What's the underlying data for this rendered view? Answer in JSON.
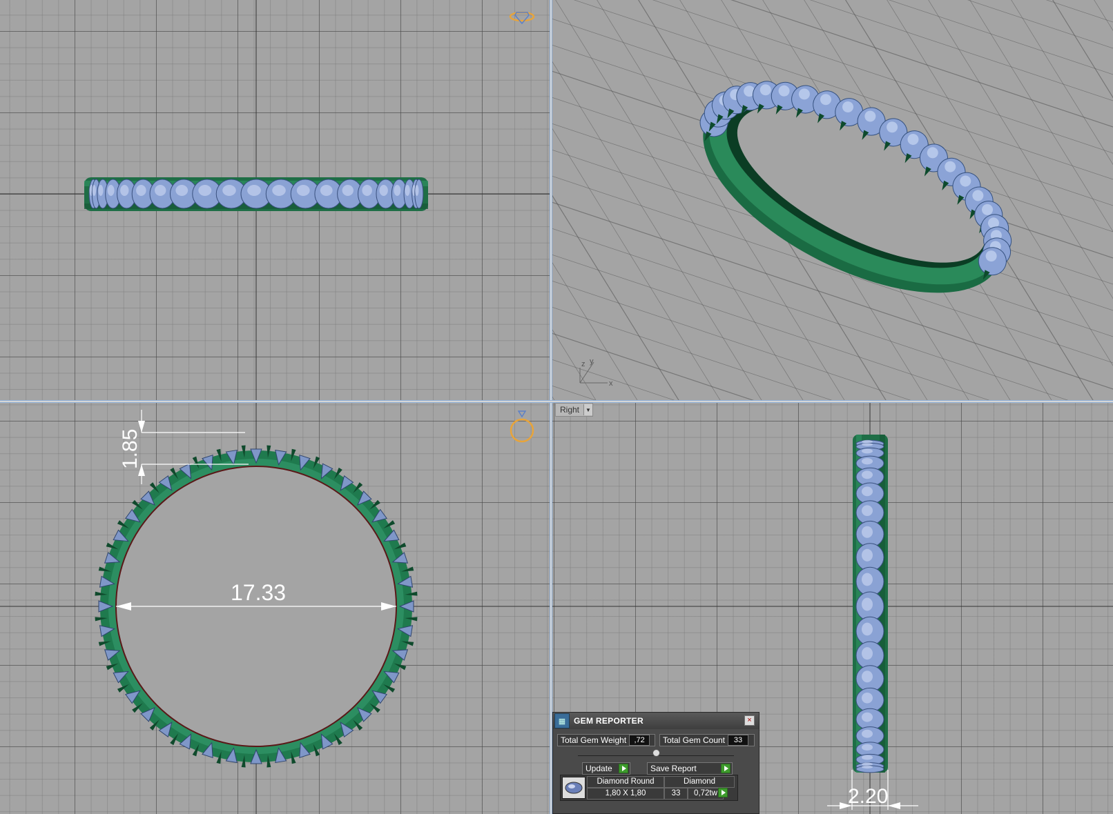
{
  "viewports": {
    "right_label": "Right",
    "axes": {
      "z": "z",
      "y": "y",
      "x": "x"
    }
  },
  "dimensions": {
    "band_height": "1.85",
    "inner_diameter": "17.33",
    "band_width": "2.20"
  },
  "gem_reporter": {
    "title": "GEM REPORTER",
    "total_weight_label": "Total Gem Weight",
    "total_weight_value": ",72",
    "total_count_label": "Total Gem Count",
    "total_count_value": "33",
    "update_label": "Update",
    "save_report_label": "Save Report",
    "gem": {
      "cut": "Diamond Round",
      "size": "1,80 X 1,80",
      "material": "Diamond",
      "count": "33",
      "weight": "0,72tw"
    }
  },
  "colors": {
    "metal": "#1f7a4e",
    "gem": "#8fa8d8",
    "background": "#a4a4a4",
    "accent": "#e8a43a"
  }
}
